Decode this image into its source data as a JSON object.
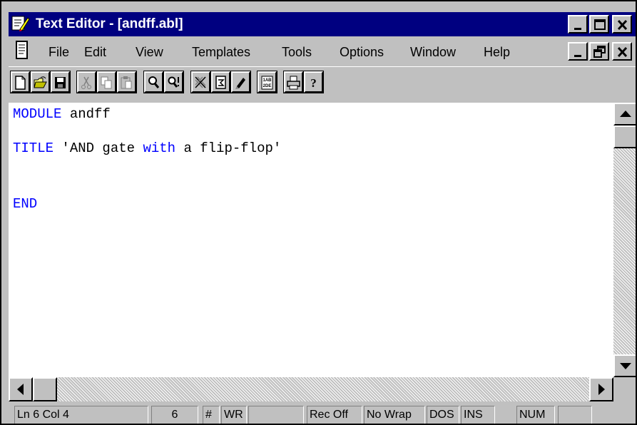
{
  "window": {
    "title": "Text Editor - [andff.abl]",
    "title_bg": "#000080",
    "controls": [
      "minimize-icon",
      "maximize-icon",
      "close-icon"
    ]
  },
  "menubar": {
    "items": [
      "File",
      "Edit",
      "View",
      "Templates",
      "Tools",
      "Options",
      "Window",
      "Help"
    ],
    "mdi_controls": [
      "minimize-icon",
      "restore-icon",
      "close-icon"
    ]
  },
  "toolbar": {
    "icons": [
      "new-icon",
      "open-icon",
      "save-icon",
      "cut-icon",
      "copy-icon",
      "paste-icon",
      "find-icon",
      "find-next-icon",
      "compile-icon",
      "insert-file-icon",
      "edit-pen-icon",
      "spelling-icon",
      "print-icon",
      "help-icon"
    ]
  },
  "editor": {
    "keyword_color": "#0000ff",
    "lines": [
      [
        {
          "t": "MODULE",
          "kw": true
        },
        {
          "t": " andff",
          "kw": false
        }
      ],
      [
        {
          "t": "TITLE",
          "kw": true
        },
        {
          "t": " 'AND gate ",
          "kw": false
        },
        {
          "t": "with",
          "kw": true
        },
        {
          "t": " a flip-flop'",
          "kw": false
        }
      ],
      [
        {
          "t": "END",
          "kw": true
        }
      ]
    ]
  },
  "statusbar": {
    "position": "Ln 6 Col 4",
    "field2": "6",
    "field3": "#",
    "field4": "WR",
    "field5": "",
    "recording": "Rec Off",
    "wrap": "No Wrap",
    "format": "DOS",
    "insert_mode": "INS",
    "numlock": "NUM",
    "field11": ""
  }
}
